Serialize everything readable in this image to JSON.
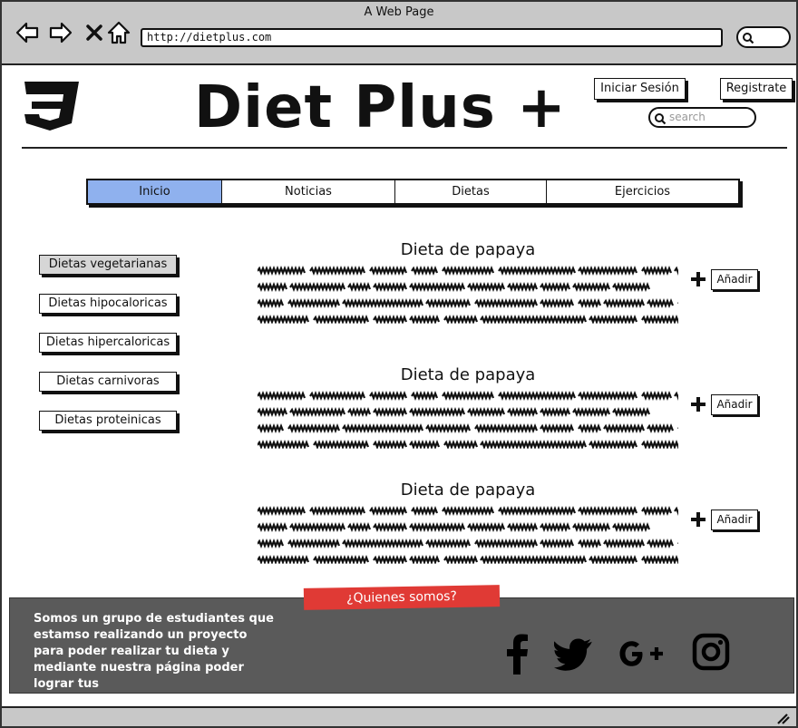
{
  "browser": {
    "window_title": "A Web Page",
    "url": "http://dietplus.com",
    "nav_icons": [
      "back-icon",
      "forward-icon",
      "stop-icon",
      "home-icon"
    ]
  },
  "header": {
    "title": "Diet Plus +",
    "login_label": "Iniciar Sesión",
    "register_label": "Registrate",
    "search_placeholder": "search"
  },
  "tabs": [
    {
      "label": "Inicio",
      "active": true
    },
    {
      "label": "Noticias",
      "active": false
    },
    {
      "label": "Dietas",
      "active": false
    },
    {
      "label": "Ejercicios",
      "active": false
    }
  ],
  "sidebar": {
    "items": [
      {
        "label": "Dietas vegetarianas",
        "selected": true
      },
      {
        "label": "Dietas hipocaloricas",
        "selected": false
      },
      {
        "label": "Dietas hipercaloricas",
        "selected": false
      },
      {
        "label": "Dietas carnivoras",
        "selected": false
      },
      {
        "label": "Dietas proteinicas",
        "selected": false
      }
    ]
  },
  "diets": [
    {
      "title": "Dieta de papaya",
      "add_label": "Añadir"
    },
    {
      "title": "Dieta de papaya",
      "add_label": "Añadir"
    },
    {
      "title": "Dieta de papaya",
      "add_label": "Añadir"
    }
  ],
  "footer": {
    "about_label": "¿Quienes somos?",
    "about_text": "Somos un grupo de estudiantes que estamso realizando un proyecto para poder realizar tu dieta y mediante nuestra página poder lograr tus",
    "social_icons": [
      "facebook-icon",
      "twitter-icon",
      "google-plus-icon",
      "instagram-icon"
    ]
  },
  "colors": {
    "active_tab": "#8fb1ee",
    "about_tag": "#e03a35",
    "footer_bg": "#5a5a5a",
    "chrome_bg": "#c8c8c8"
  }
}
